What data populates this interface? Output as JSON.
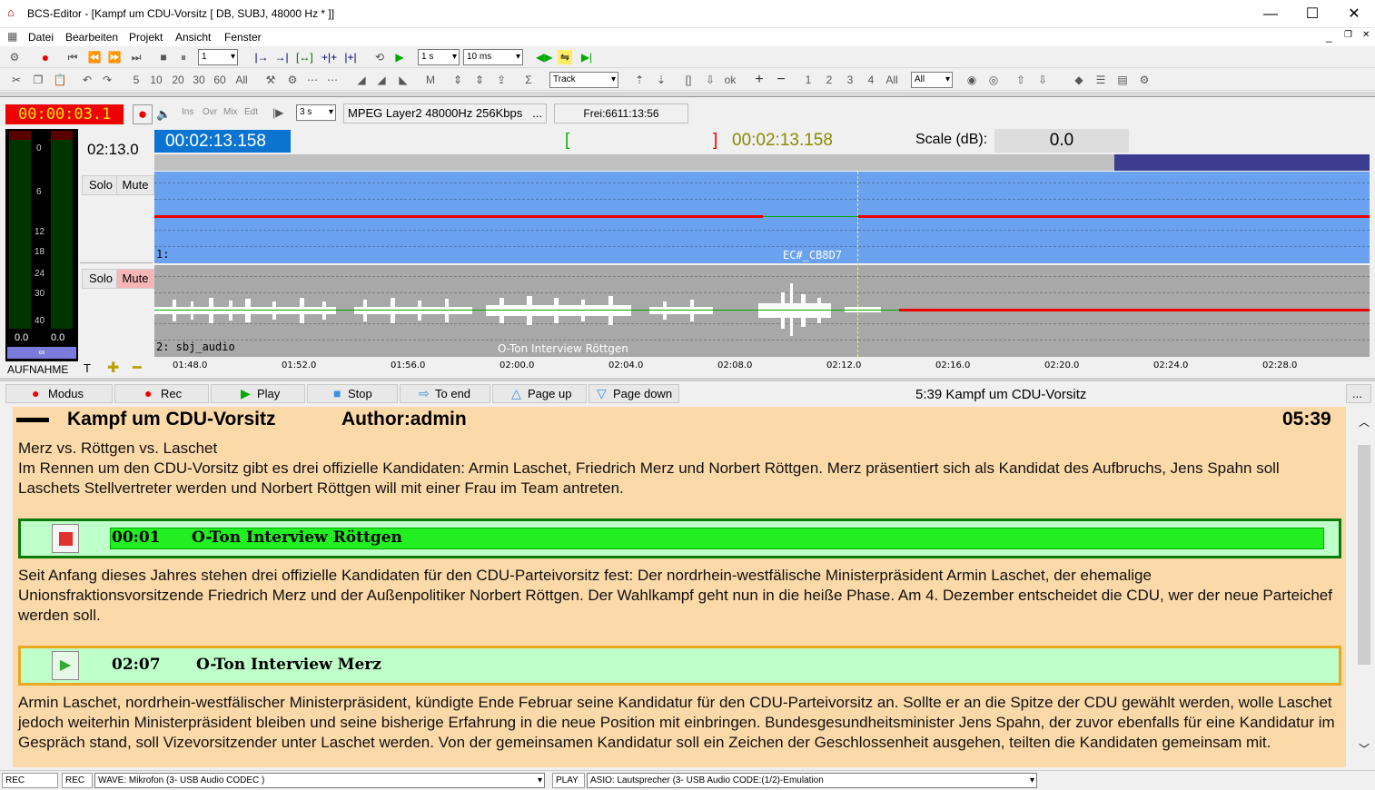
{
  "app": {
    "title": "BCS-Editor - [Kampf um CDU-Vorsitz [ DB, SUBJ, 48000 Hz * ]]",
    "menu": [
      "Datei",
      "Bearbeiten",
      "Projekt",
      "Ansicht",
      "Fenster"
    ]
  },
  "toolbar1": {
    "step_value": "1",
    "interval1": "1 s",
    "interval2": "10 ms"
  },
  "toolbar2": {
    "numbers": [
      "5",
      "10",
      "20",
      "30",
      "60",
      "All"
    ],
    "mode_select": "Track",
    "track_numbers": [
      "1",
      "2",
      "3",
      "4",
      "All"
    ],
    "all_select": "All"
  },
  "transport": {
    "rec_time": "00:00:03.1",
    "modes": [
      "Ins",
      "Ovr",
      "Mix",
      "Edt"
    ],
    "pre_roll": "3 s",
    "format": "MPEG Layer2 48000Hz 256Kbps",
    "more": "...",
    "free": "Frei:6611:13:56"
  },
  "position": {
    "length": "02:13.0",
    "cursor": "00:02:13.158",
    "mark_in": "[",
    "mark_out": "]",
    "mark_time": "00:02:13.158",
    "scale_label": "Scale (dB):",
    "scale_value": "0.0"
  },
  "meter": {
    "scale": [
      "0",
      "6",
      "12",
      "18",
      "24",
      "30",
      "40"
    ],
    "left_value": "0.0",
    "right_value": "0.0",
    "label": "AUFNAHME"
  },
  "tracks": [
    {
      "solo": "Solo",
      "mute": "Mute",
      "label": "1:",
      "clip": "EC#_CB8D7"
    },
    {
      "solo": "Solo",
      "mute": "Mute",
      "label": "2: sbj_audio",
      "clip": "O-Ton Interview Röttgen"
    }
  ],
  "ruler": [
    "01:48.0",
    "01:52.0",
    "01:56.0",
    "02:00.0",
    "02:04.0",
    "02:08.0",
    "02:12.0",
    "02:16.0",
    "02:20.0",
    "02:24.0",
    "02:28.0"
  ],
  "buttons": {
    "modus": "Modus",
    "rec": "Rec",
    "play": "Play",
    "stop": "Stop",
    "to_end": "To end",
    "page_up": "Page up",
    "page_down": "Page down",
    "story_info": "5:39  Kampf um CDU-Vorsitz",
    "more": "..."
  },
  "story": {
    "title": "Kampf um CDU-Vorsitz",
    "author": "Author:admin",
    "duration": "05:39",
    "intro_line1": "Merz vs. Röttgen vs. Laschet",
    "intro_line2": "Im Rennen um den CDU-Vorsitz gibt es drei offizielle Kandidaten: Armin Laschet, Friedrich Merz und Norbert Röttgen. Merz präsentiert sich als Kandidat des Aufbruchs, Jens Spahn soll Laschets Stellvertreter werden und Norbert Röttgen will mit einer Frau im Team antreten.",
    "clip1_time": "00:01",
    "clip1_title": "O-Ton Interview Röttgen",
    "para2": "Seit Anfang dieses Jahres stehen drei offizielle Kandidaten für den CDU-Parteivorsitz fest: Der nordrhein-westfälische Ministerpräsident Armin Laschet, der ehemalige Unionsfraktionsvorsitzende Friedrich Merz und der Außenpolitiker Norbert Röttgen. Der Wahlkampf geht nun in die heiße Phase. Am 4. Dezember entscheidet die CDU, wer der neue Parteichef werden soll.",
    "clip2_time": "02:07",
    "clip2_title": "O-Ton Interview Merz",
    "para3": "Armin Laschet, nordrhein-westfälischer Ministerpräsident, kündigte Ende Februar seine Kandidatur für den CDU-Parteivorsitz an. Sollte er an die Spitze der CDU gewählt werden, wolle Laschet jedoch weiterhin Ministerpräsident bleiben und seine bisherige Erfahrung in die neue Position mit einbringen. Bundesgesundheitsminister Jens Spahn, der zuvor ebenfalls für eine Kandidatur im Gespräch stand, soll Vizevorsitzender unter Laschet werden. Von der gemeinsamen Kandidatur soll ein Zeichen der Geschlossenheit ausgehen, teilten die Kandidaten gemeinsam mit."
  },
  "statusbar": {
    "rec1": "REC",
    "rec2": "REC",
    "rec_device": "WAVE: Mikrofon (3- USB Audio CODEC )",
    "play": "PLAY",
    "play_device": "ASIO: Lautsprecher (3- USB Audio CODE:(1/2)-Emulation"
  },
  "colors": {
    "accent": "#0b74d1",
    "rec_red": "#e00000",
    "clip_green": "#22ee22",
    "story_bg": "#fcd9a8"
  }
}
